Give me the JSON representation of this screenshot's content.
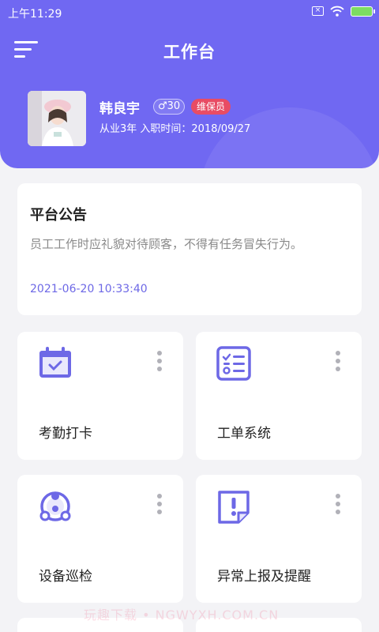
{
  "status_bar": {
    "time": "上午11:29",
    "sim_icon": "sim-off-icon",
    "wifi_icon": "wifi-icon",
    "battery_icon": "battery-charging-icon"
  },
  "header": {
    "title": "工作台",
    "menu_icon": "menu-icon"
  },
  "profile": {
    "name": "韩良宇",
    "gender_age": "♂30",
    "role": "维保员",
    "meta": "从业3年  入职时间：2018/09/27"
  },
  "notice": {
    "title": "平台公告",
    "body": "员工工作时应礼貌对待顾客，不得有任务冒失行为。",
    "date": "2021-06-20 10:33:40"
  },
  "cards": [
    {
      "label": "考勤打卡",
      "icon": "calendar-check-icon"
    },
    {
      "label": "工单系统",
      "icon": "checklist-icon"
    },
    {
      "label": "设备巡检",
      "icon": "device-network-icon"
    },
    {
      "label": "异常上报及提醒",
      "icon": "exception-report-icon"
    }
  ],
  "watermark": "玩趣下载 • NGWYXH.COM.CN",
  "colors": {
    "primary": "#7068f2",
    "role_badge": "#e84c64",
    "date": "#6d68e6",
    "background": "#f3f3f6"
  }
}
